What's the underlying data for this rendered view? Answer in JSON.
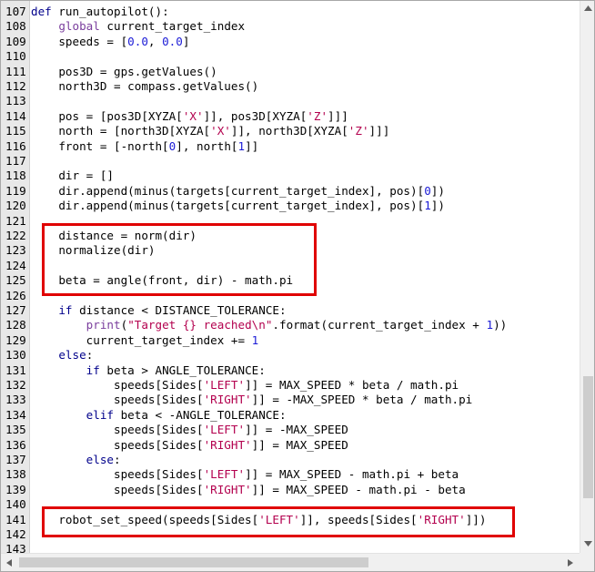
{
  "editor": {
    "lines": [
      {
        "n": "107",
        "t": [
          {
            "c": "kw",
            "v": "def"
          },
          {
            "v": " run_autopilot():"
          }
        ]
      },
      {
        "n": "108",
        "t": [
          {
            "v": "    "
          },
          {
            "c": "kw2",
            "v": "global"
          },
          {
            "v": " current_target_index"
          }
        ]
      },
      {
        "n": "109",
        "t": [
          {
            "v": "    speeds = ["
          },
          {
            "c": "num",
            "v": "0.0"
          },
          {
            "v": ", "
          },
          {
            "c": "num",
            "v": "0.0"
          },
          {
            "v": "]"
          }
        ]
      },
      {
        "n": "110",
        "t": [
          {
            "v": ""
          }
        ]
      },
      {
        "n": "111",
        "t": [
          {
            "v": "    pos3D = gps.getValues()"
          }
        ]
      },
      {
        "n": "112",
        "t": [
          {
            "v": "    north3D = compass.getValues()"
          }
        ]
      },
      {
        "n": "113",
        "t": [
          {
            "v": ""
          }
        ]
      },
      {
        "n": "114",
        "t": [
          {
            "v": "    pos = [pos3D[XYZA["
          },
          {
            "c": "str",
            "v": "'X'"
          },
          {
            "v": "]], pos3D[XYZA["
          },
          {
            "c": "str",
            "v": "'Z'"
          },
          {
            "v": "]]]"
          }
        ]
      },
      {
        "n": "115",
        "t": [
          {
            "v": "    north = [north3D[XYZA["
          },
          {
            "c": "str",
            "v": "'X'"
          },
          {
            "v": "]], north3D[XYZA["
          },
          {
            "c": "str",
            "v": "'Z'"
          },
          {
            "v": "]]]"
          }
        ]
      },
      {
        "n": "116",
        "t": [
          {
            "v": "    front = [-north["
          },
          {
            "c": "num",
            "v": "0"
          },
          {
            "v": "], north["
          },
          {
            "c": "num",
            "v": "1"
          },
          {
            "v": "]]"
          }
        ]
      },
      {
        "n": "117",
        "t": [
          {
            "v": ""
          }
        ]
      },
      {
        "n": "118",
        "t": [
          {
            "v": "    dir = []"
          }
        ]
      },
      {
        "n": "119",
        "t": [
          {
            "v": "    dir.append(minus(targets[current_target_index], pos)["
          },
          {
            "c": "num",
            "v": "0"
          },
          {
            "v": "])"
          }
        ]
      },
      {
        "n": "120",
        "t": [
          {
            "v": "    dir.append(minus(targets[current_target_index], pos)["
          },
          {
            "c": "num",
            "v": "1"
          },
          {
            "v": "])"
          }
        ]
      },
      {
        "n": "121",
        "t": [
          {
            "v": ""
          }
        ]
      },
      {
        "n": "122",
        "t": [
          {
            "v": "    distance = norm(dir)"
          }
        ]
      },
      {
        "n": "123",
        "t": [
          {
            "v": "    normalize(dir)"
          }
        ]
      },
      {
        "n": "124",
        "t": [
          {
            "v": ""
          }
        ]
      },
      {
        "n": "125",
        "t": [
          {
            "v": "    beta = angle(front, dir) - math.pi"
          }
        ]
      },
      {
        "n": "126",
        "t": [
          {
            "v": ""
          }
        ]
      },
      {
        "n": "127",
        "t": [
          {
            "v": "    "
          },
          {
            "c": "kw",
            "v": "if"
          },
          {
            "v": " distance < DISTANCE_TOLERANCE:"
          }
        ]
      },
      {
        "n": "128",
        "t": [
          {
            "v": "        "
          },
          {
            "c": "kw2",
            "v": "print"
          },
          {
            "v": "("
          },
          {
            "c": "str",
            "v": "\"Target {} reached\\n\""
          },
          {
            "v": ".format(current_target_index + "
          },
          {
            "c": "num",
            "v": "1"
          },
          {
            "v": "))"
          }
        ]
      },
      {
        "n": "129",
        "t": [
          {
            "v": "        current_target_index += "
          },
          {
            "c": "num",
            "v": "1"
          }
        ]
      },
      {
        "n": "130",
        "t": [
          {
            "v": "    "
          },
          {
            "c": "kw",
            "v": "else"
          },
          {
            "v": ":"
          }
        ]
      },
      {
        "n": "131",
        "t": [
          {
            "v": "        "
          },
          {
            "c": "kw",
            "v": "if"
          },
          {
            "v": " beta > ANGLE_TOLERANCE:"
          }
        ]
      },
      {
        "n": "132",
        "t": [
          {
            "v": "            speeds[Sides["
          },
          {
            "c": "str",
            "v": "'LEFT'"
          },
          {
            "v": "]] = MAX_SPEED * beta / math.pi"
          }
        ]
      },
      {
        "n": "133",
        "t": [
          {
            "v": "            speeds[Sides["
          },
          {
            "c": "str",
            "v": "'RIGHT'"
          },
          {
            "v": "]] = -MAX_SPEED * beta / math.pi"
          }
        ]
      },
      {
        "n": "134",
        "t": [
          {
            "v": "        "
          },
          {
            "c": "kw",
            "v": "elif"
          },
          {
            "v": " beta < -ANGLE_TOLERANCE:"
          }
        ]
      },
      {
        "n": "135",
        "t": [
          {
            "v": "            speeds[Sides["
          },
          {
            "c": "str",
            "v": "'LEFT'"
          },
          {
            "v": "]] = -MAX_SPEED"
          }
        ]
      },
      {
        "n": "136",
        "t": [
          {
            "v": "            speeds[Sides["
          },
          {
            "c": "str",
            "v": "'RIGHT'"
          },
          {
            "v": "]] = MAX_SPEED"
          }
        ]
      },
      {
        "n": "137",
        "t": [
          {
            "v": "        "
          },
          {
            "c": "kw",
            "v": "else"
          },
          {
            "v": ":"
          }
        ]
      },
      {
        "n": "138",
        "t": [
          {
            "v": "            speeds[Sides["
          },
          {
            "c": "str",
            "v": "'LEFT'"
          },
          {
            "v": "]] = MAX_SPEED - math.pi + beta"
          }
        ]
      },
      {
        "n": "139",
        "t": [
          {
            "v": "            speeds[Sides["
          },
          {
            "c": "str",
            "v": "'RIGHT'"
          },
          {
            "v": "]] = MAX_SPEED - math.pi - beta"
          }
        ]
      },
      {
        "n": "140",
        "t": [
          {
            "v": ""
          }
        ]
      },
      {
        "n": "141",
        "t": [
          {
            "v": "    robot_set_speed(speeds[Sides["
          },
          {
            "c": "str",
            "v": "'LEFT'"
          },
          {
            "v": "]], speeds[Sides["
          },
          {
            "c": "str",
            "v": "'RIGHT'"
          },
          {
            "v": "]])"
          }
        ]
      },
      {
        "n": "142",
        "t": [
          {
            "v": ""
          }
        ]
      },
      {
        "n": "143",
        "t": [
          {
            "v": ""
          }
        ]
      }
    ],
    "highlight_color": "#e00000",
    "highlighted_blocks": [
      {
        "from_line": "122",
        "to_line": "125"
      },
      {
        "from_line": "141",
        "to_line": "141"
      }
    ]
  },
  "scrollbars": {
    "up_icon": "scroll-up-arrow-icon",
    "down_icon": "scroll-down-arrow-icon",
    "left_icon": "scroll-left-arrow-icon",
    "right_icon": "scroll-right-arrow-icon"
  }
}
